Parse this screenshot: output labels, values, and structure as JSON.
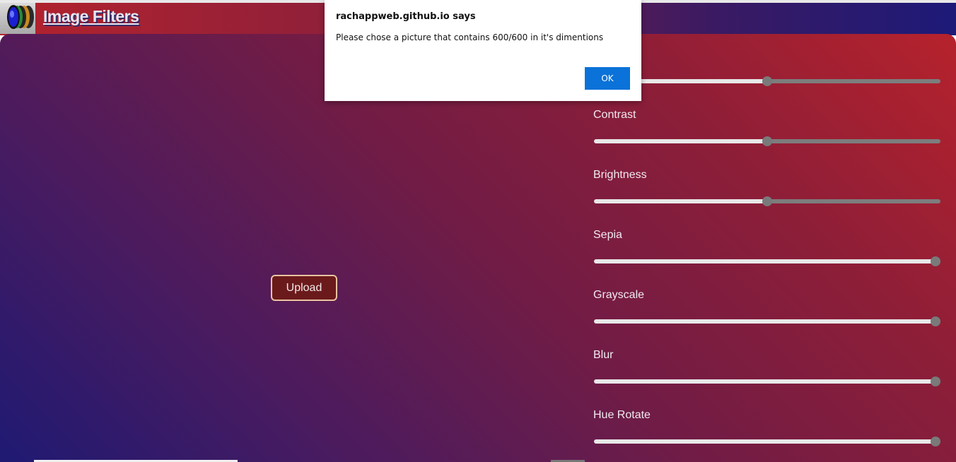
{
  "header": {
    "title": "Image Filters",
    "logo_icon": "camera-lens-icon"
  },
  "upload": {
    "label": "Upload"
  },
  "filters": [
    {
      "name": "",
      "value_fraction": 0.5
    },
    {
      "name": "Contrast",
      "value_fraction": 0.5
    },
    {
      "name": "Brightness",
      "value_fraction": 0.5
    },
    {
      "name": "Sepia",
      "value_fraction": 1.0
    },
    {
      "name": "Grayscale",
      "value_fraction": 1.0
    },
    {
      "name": "Blur",
      "value_fraction": 1.0
    },
    {
      "name": "Hue Rotate",
      "value_fraction": 1.0
    }
  ],
  "dialog": {
    "title": "rachappweb.github.io says",
    "message": "Please chose a picture that contains 600/600 in it's dimentions",
    "ok_label": "OK"
  },
  "colors": {
    "accent_blue": "#0a72d8",
    "upload_bg": "#6b1a1c",
    "gradient_start": "#1f1a73",
    "gradient_end": "#b6222c"
  }
}
